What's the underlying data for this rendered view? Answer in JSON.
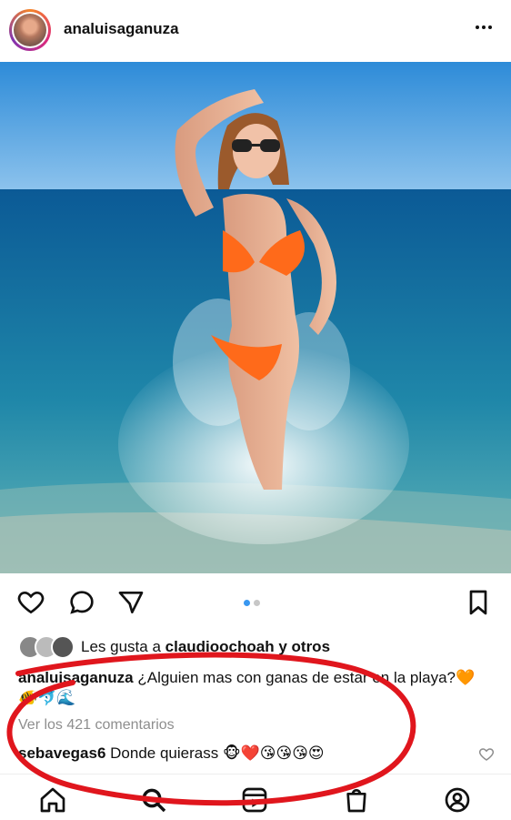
{
  "post": {
    "username": "analuisaganuza",
    "image_alt": "Woman in orange bikini standing in ocean splash",
    "carousel_pages": 2,
    "carousel_active": 1
  },
  "likes": {
    "prefix": "Les gusta a",
    "user": "claudioochoah",
    "suffix": "y otros"
  },
  "caption": {
    "username": "analuisaganuza",
    "text": "¿Alguien mas con ganas de estar en la playa?🧡🐠🐬🌊"
  },
  "comments": {
    "view_all": "Ver los 421 comentarios",
    "items": [
      {
        "username": "sebavegas6",
        "text": "Donde quierass 🐵❤️😘😘😘😍"
      }
    ]
  },
  "colors": {
    "annotation_red": "#e0161d",
    "link_blue": "#3897f0",
    "muted_gray": "#8e8e8e"
  },
  "icons": {
    "header_more": "more-icon",
    "actions": [
      "heart-icon",
      "comment-icon",
      "share-icon",
      "bookmark-icon"
    ],
    "tabbar": [
      "home-icon",
      "search-icon",
      "reels-icon",
      "shop-icon",
      "profile-icon"
    ]
  }
}
